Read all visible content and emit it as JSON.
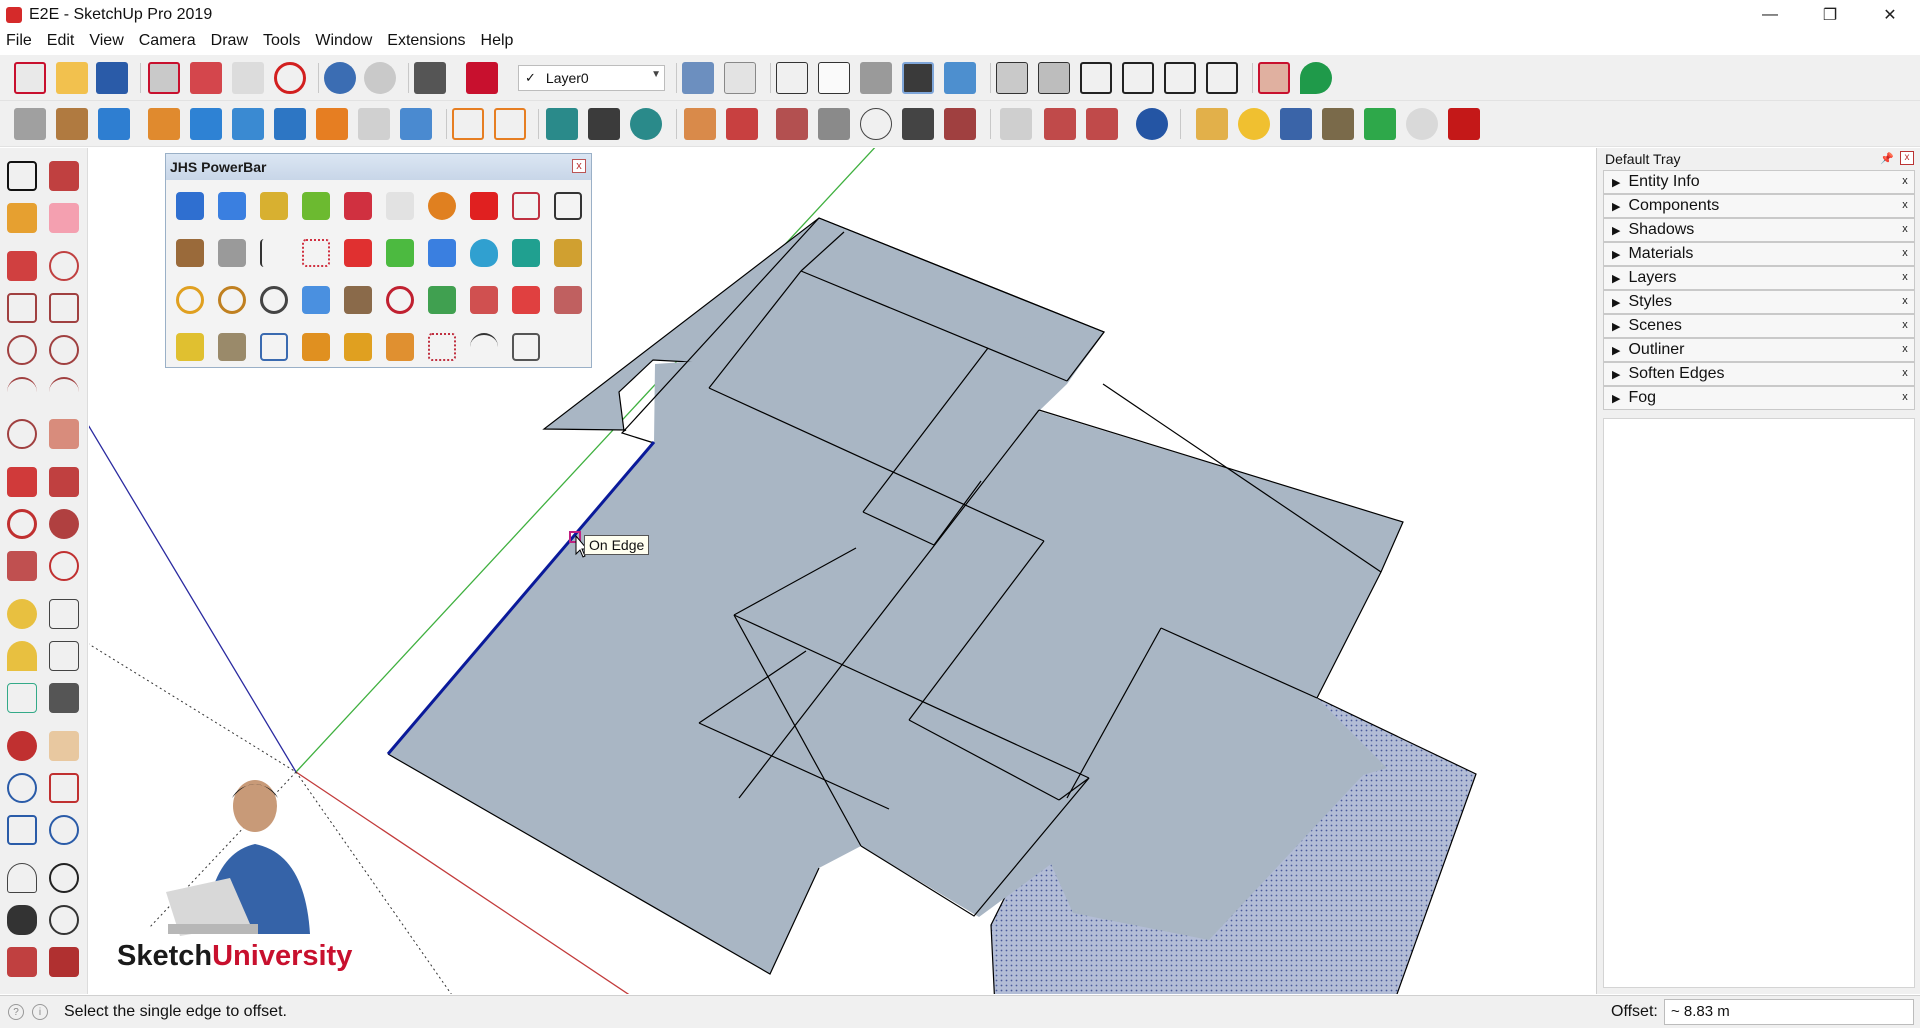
{
  "window": {
    "title": "E2E - SketchUp Pro 2019",
    "minimize": "—",
    "maximize": "❐",
    "close": "✕"
  },
  "menu": [
    "File",
    "Edit",
    "View",
    "Camera",
    "Draw",
    "Tools",
    "Window",
    "Extensions",
    "Help"
  ],
  "layer": {
    "check": "✓",
    "current": "Layer0",
    "arrow": "▼"
  },
  "tooltip": "On Edge",
  "powerbar": {
    "title": "JHS PowerBar",
    "close": "x"
  },
  "brand": {
    "part1": "Sketch",
    "part2": "University"
  },
  "tray": {
    "title": "Default Tray",
    "pin": "📌",
    "close": "x",
    "panels": [
      "Entity Info",
      "Components",
      "Shadows",
      "Materials",
      "Layers",
      "Styles",
      "Scenes",
      "Outliner",
      "Soften Edges",
      "Fog"
    ],
    "panel_close": "x",
    "expand_glyph": "▶"
  },
  "status": {
    "hint_icon_1": "?",
    "hint_icon_2": "i",
    "message": "Select the single edge to offset.",
    "offset_label": "Offset:",
    "offset_value": "~ 8.83 m"
  },
  "colors": {
    "face": "#a9b6c4",
    "axis_green": "#3fb03f",
    "axis_red": "#c23b3b",
    "axis_blue": "#2a2aa0",
    "selected_edge": "#0a1a9a",
    "brand_red": "#c8102e"
  }
}
